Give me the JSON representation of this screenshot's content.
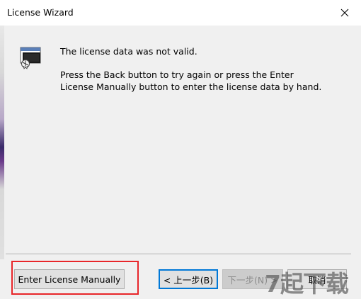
{
  "window": {
    "title": "License Wizard",
    "close_glyph": "✕"
  },
  "content": {
    "icon": "license-wizard-icon",
    "message_primary": "The license data was not valid.",
    "message_secondary": "Press the Back button to try again or press the Enter License Manually button to enter the license data by hand."
  },
  "buttons": {
    "enter_manually": "Enter License Manually",
    "back": "< 上一步(B)",
    "next": "下一步(N) >",
    "cancel": "取消"
  },
  "watermark": {
    "text": "7起下载"
  },
  "colors": {
    "dialog_bg": "#f0f0f0",
    "focus_border": "#0078d7",
    "highlight_box": "#e8262a"
  }
}
